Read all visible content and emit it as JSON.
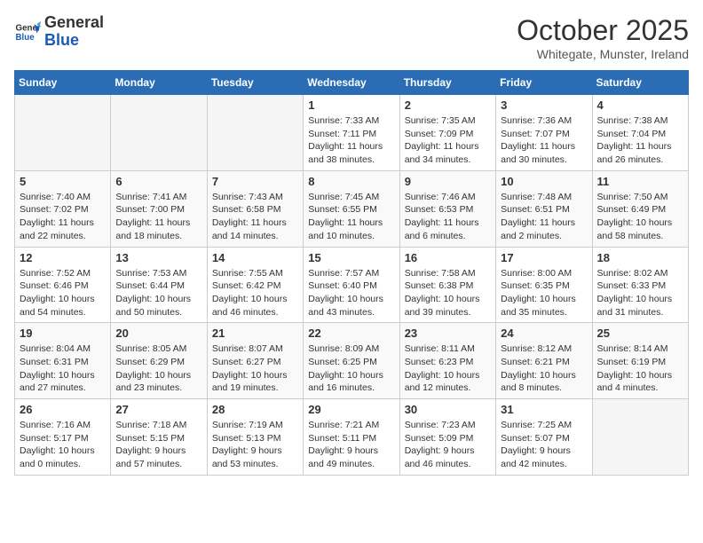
{
  "header": {
    "logo_line1": "General",
    "logo_line2": "Blue",
    "month": "October 2025",
    "location": "Whitegate, Munster, Ireland"
  },
  "days_of_week": [
    "Sunday",
    "Monday",
    "Tuesday",
    "Wednesday",
    "Thursday",
    "Friday",
    "Saturday"
  ],
  "weeks": [
    [
      {
        "day": "",
        "info": ""
      },
      {
        "day": "",
        "info": ""
      },
      {
        "day": "",
        "info": ""
      },
      {
        "day": "1",
        "info": "Sunrise: 7:33 AM\nSunset: 7:11 PM\nDaylight: 11 hours\nand 38 minutes."
      },
      {
        "day": "2",
        "info": "Sunrise: 7:35 AM\nSunset: 7:09 PM\nDaylight: 11 hours\nand 34 minutes."
      },
      {
        "day": "3",
        "info": "Sunrise: 7:36 AM\nSunset: 7:07 PM\nDaylight: 11 hours\nand 30 minutes."
      },
      {
        "day": "4",
        "info": "Sunrise: 7:38 AM\nSunset: 7:04 PM\nDaylight: 11 hours\nand 26 minutes."
      }
    ],
    [
      {
        "day": "5",
        "info": "Sunrise: 7:40 AM\nSunset: 7:02 PM\nDaylight: 11 hours\nand 22 minutes."
      },
      {
        "day": "6",
        "info": "Sunrise: 7:41 AM\nSunset: 7:00 PM\nDaylight: 11 hours\nand 18 minutes."
      },
      {
        "day": "7",
        "info": "Sunrise: 7:43 AM\nSunset: 6:58 PM\nDaylight: 11 hours\nand 14 minutes."
      },
      {
        "day": "8",
        "info": "Sunrise: 7:45 AM\nSunset: 6:55 PM\nDaylight: 11 hours\nand 10 minutes."
      },
      {
        "day": "9",
        "info": "Sunrise: 7:46 AM\nSunset: 6:53 PM\nDaylight: 11 hours\nand 6 minutes."
      },
      {
        "day": "10",
        "info": "Sunrise: 7:48 AM\nSunset: 6:51 PM\nDaylight: 11 hours\nand 2 minutes."
      },
      {
        "day": "11",
        "info": "Sunrise: 7:50 AM\nSunset: 6:49 PM\nDaylight: 10 hours\nand 58 minutes."
      }
    ],
    [
      {
        "day": "12",
        "info": "Sunrise: 7:52 AM\nSunset: 6:46 PM\nDaylight: 10 hours\nand 54 minutes."
      },
      {
        "day": "13",
        "info": "Sunrise: 7:53 AM\nSunset: 6:44 PM\nDaylight: 10 hours\nand 50 minutes."
      },
      {
        "day": "14",
        "info": "Sunrise: 7:55 AM\nSunset: 6:42 PM\nDaylight: 10 hours\nand 46 minutes."
      },
      {
        "day": "15",
        "info": "Sunrise: 7:57 AM\nSunset: 6:40 PM\nDaylight: 10 hours\nand 43 minutes."
      },
      {
        "day": "16",
        "info": "Sunrise: 7:58 AM\nSunset: 6:38 PM\nDaylight: 10 hours\nand 39 minutes."
      },
      {
        "day": "17",
        "info": "Sunrise: 8:00 AM\nSunset: 6:35 PM\nDaylight: 10 hours\nand 35 minutes."
      },
      {
        "day": "18",
        "info": "Sunrise: 8:02 AM\nSunset: 6:33 PM\nDaylight: 10 hours\nand 31 minutes."
      }
    ],
    [
      {
        "day": "19",
        "info": "Sunrise: 8:04 AM\nSunset: 6:31 PM\nDaylight: 10 hours\nand 27 minutes."
      },
      {
        "day": "20",
        "info": "Sunrise: 8:05 AM\nSunset: 6:29 PM\nDaylight: 10 hours\nand 23 minutes."
      },
      {
        "day": "21",
        "info": "Sunrise: 8:07 AM\nSunset: 6:27 PM\nDaylight: 10 hours\nand 19 minutes."
      },
      {
        "day": "22",
        "info": "Sunrise: 8:09 AM\nSunset: 6:25 PM\nDaylight: 10 hours\nand 16 minutes."
      },
      {
        "day": "23",
        "info": "Sunrise: 8:11 AM\nSunset: 6:23 PM\nDaylight: 10 hours\nand 12 minutes."
      },
      {
        "day": "24",
        "info": "Sunrise: 8:12 AM\nSunset: 6:21 PM\nDaylight: 10 hours\nand 8 minutes."
      },
      {
        "day": "25",
        "info": "Sunrise: 8:14 AM\nSunset: 6:19 PM\nDaylight: 10 hours\nand 4 minutes."
      }
    ],
    [
      {
        "day": "26",
        "info": "Sunrise: 7:16 AM\nSunset: 5:17 PM\nDaylight: 10 hours\nand 0 minutes."
      },
      {
        "day": "27",
        "info": "Sunrise: 7:18 AM\nSunset: 5:15 PM\nDaylight: 9 hours\nand 57 minutes."
      },
      {
        "day": "28",
        "info": "Sunrise: 7:19 AM\nSunset: 5:13 PM\nDaylight: 9 hours\nand 53 minutes."
      },
      {
        "day": "29",
        "info": "Sunrise: 7:21 AM\nSunset: 5:11 PM\nDaylight: 9 hours\nand 49 minutes."
      },
      {
        "day": "30",
        "info": "Sunrise: 7:23 AM\nSunset: 5:09 PM\nDaylight: 9 hours\nand 46 minutes."
      },
      {
        "day": "31",
        "info": "Sunrise: 7:25 AM\nSunset: 5:07 PM\nDaylight: 9 hours\nand 42 minutes."
      },
      {
        "day": "",
        "info": ""
      }
    ]
  ]
}
